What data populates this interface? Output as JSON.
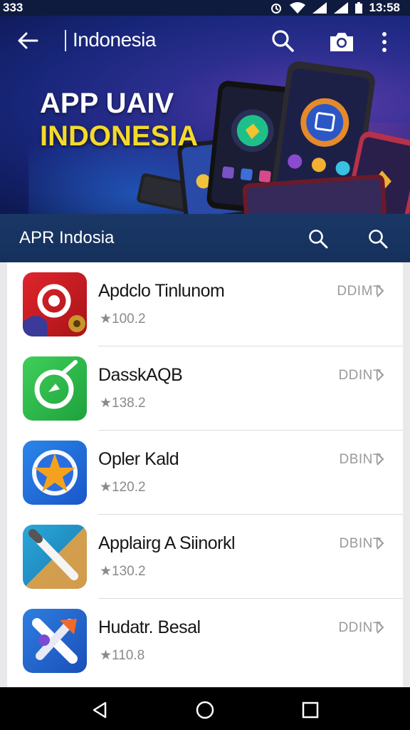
{
  "status_bar": {
    "left_text": "333",
    "time": "13:58"
  },
  "appbar": {
    "title": "Indonesia",
    "icons": [
      "back-arrow-icon",
      "search-icon",
      "camera-icon",
      "more-vert-icon"
    ]
  },
  "hero": {
    "line1": "APP UAIV",
    "line2": "INDONESIA"
  },
  "subheader": {
    "label": "APR Indosia",
    "icons": [
      "search-icon",
      "search-icon"
    ]
  },
  "apps": [
    {
      "name": "Apdclo Tinlunom",
      "rating": "★100.2",
      "action": "DDIMT",
      "icon": "app-red-icon"
    },
    {
      "name": "DasskAQB",
      "rating": "★138.2",
      "action": "DDINT",
      "icon": "app-green-icon"
    },
    {
      "name": "Opler Kald",
      "rating": "★120.2",
      "action": "DBINT",
      "icon": "app-star-icon"
    },
    {
      "name": "Applairg A Siinorkl",
      "rating": "★130.2",
      "action": "DBINT",
      "icon": "app-pencil-icon"
    },
    {
      "name": "Hudatr. Besal",
      "rating": "★110.8",
      "action": "DDINT",
      "icon": "app-blue-x-icon"
    }
  ],
  "navbar": {
    "icons": [
      "back-triangle-icon",
      "home-circle-icon",
      "recents-square-icon"
    ]
  },
  "colors": {
    "hero_bg": "#18267a",
    "subheader_bg": "#1a3766",
    "accent_yellow": "#f4d92a"
  }
}
